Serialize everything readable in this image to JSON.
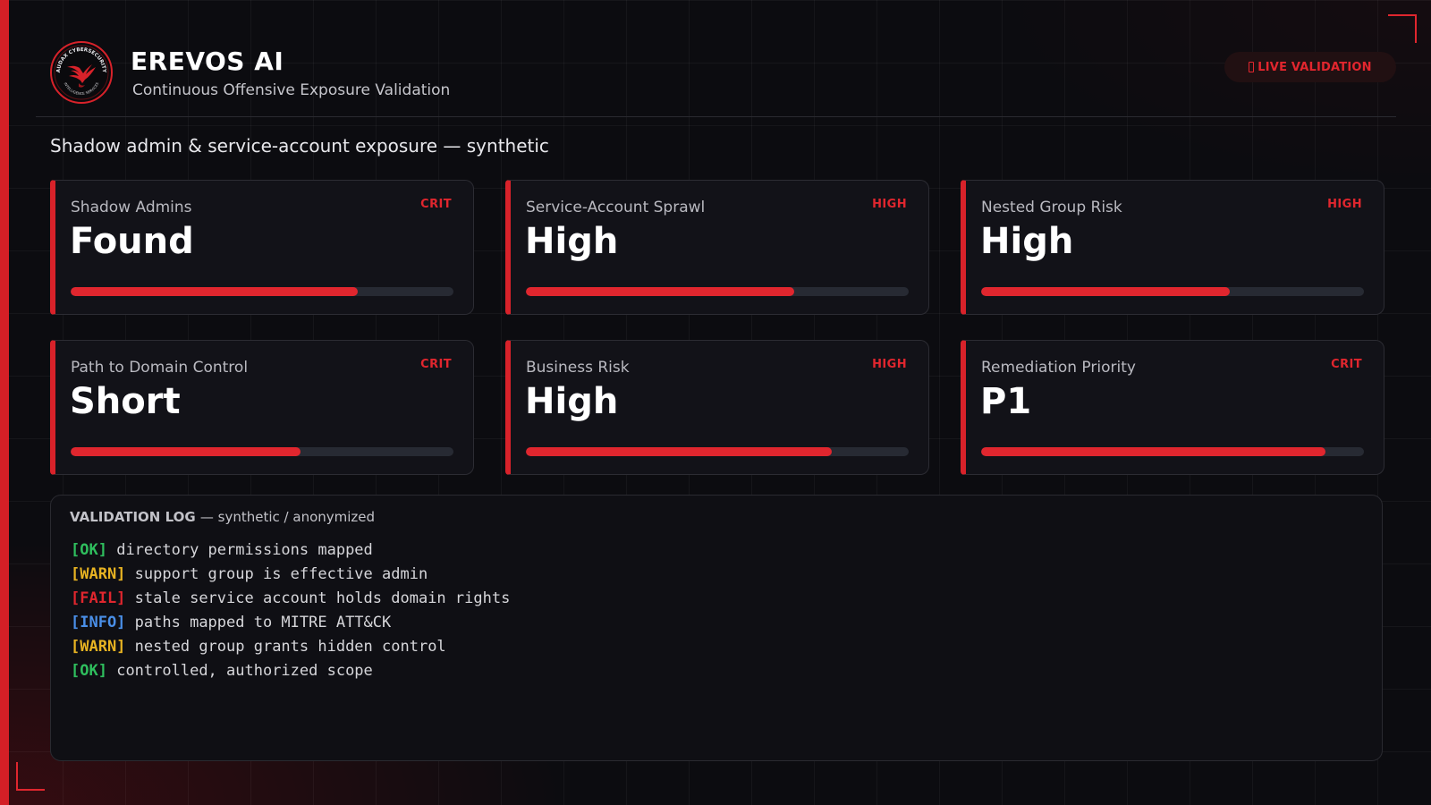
{
  "header": {
    "title": "EREVOS AI",
    "subtitle": "Continuous Offensive Exposure Validation",
    "badge": "LIVE VALIDATION",
    "logo_text": "AUDAX CYBERSECURITY",
    "logo_subtext": "INTELLIGENCE SERVICES"
  },
  "section_title": "Shadow admin & service-account exposure — synthetic",
  "cards": [
    {
      "label": "Shadow Admins",
      "severity": "CRIT",
      "value": "Found",
      "level": 0.75
    },
    {
      "label": "Service-Account Sprawl",
      "severity": "HIGH",
      "value": "High",
      "level": 0.7
    },
    {
      "label": "Nested Group Risk",
      "severity": "HIGH",
      "value": "High",
      "level": 0.65
    },
    {
      "label": "Path to Domain Control",
      "severity": "CRIT",
      "value": "Short",
      "level": 0.6
    },
    {
      "label": "Business Risk",
      "severity": "HIGH",
      "value": "High",
      "level": 0.8
    },
    {
      "label": "Remediation Priority",
      "severity": "CRIT",
      "value": "P1",
      "level": 0.9
    }
  ],
  "log": {
    "title": "VALIDATION LOG",
    "title_suffix": "— synthetic / anonymized",
    "lines": [
      {
        "tag": "[OK]",
        "text": "directory permissions mapped"
      },
      {
        "tag": "[WARN]",
        "text": "support group is effective admin"
      },
      {
        "tag": "[FAIL]",
        "text": "stale service account holds domain rights"
      },
      {
        "tag": "[INFO]",
        "text": "paths mapped to MITRE ATT&CK"
      },
      {
        "tag": "[WARN]",
        "text": "nested group grants hidden control"
      },
      {
        "tag": "[OK]",
        "text": "controlled, authorized scope"
      }
    ]
  },
  "colors": {
    "accent": "#e0262e",
    "ok": "#2fbf5e",
    "warn": "#e8b322",
    "fail": "#e0262e",
    "info": "#4a8fe8"
  },
  "icons": {
    "badge": "live-indicator-icon",
    "logo": "eagle-emblem-icon"
  }
}
